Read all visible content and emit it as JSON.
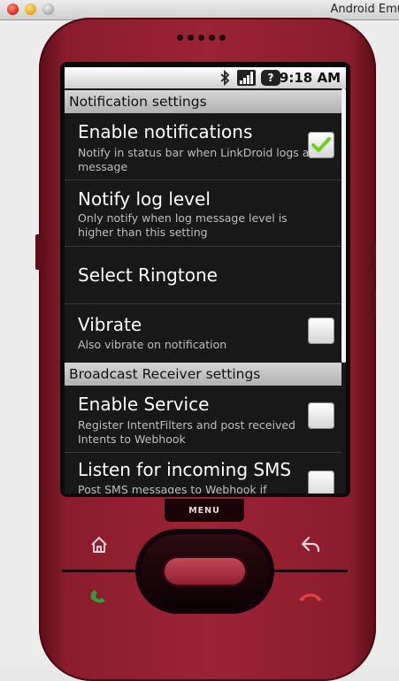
{
  "window": {
    "title": "Android Emu"
  },
  "status_bar": {
    "time": "9:18 AM",
    "icons": [
      "bluetooth-icon",
      "signal-icon",
      "battery-unknown-icon"
    ],
    "battery_glyph": "?"
  },
  "settings": {
    "section_notifications": "Notification settings",
    "enable_notifications": {
      "title": "Enable notifications",
      "summary": "Notify in status bar when LinkDroid logs a message",
      "checked": true
    },
    "notify_log_level": {
      "title": "Notify log level",
      "summary": "Only notify when log message level is higher than this setting"
    },
    "select_ringtone": {
      "title": "Select Ringtone"
    },
    "vibrate": {
      "title": "Vibrate",
      "summary": "Also vibrate on notification",
      "checked": false
    },
    "section_broadcast": "Broadcast Receiver settings",
    "enable_service": {
      "title": "Enable Service",
      "summary": "Register IntentFilters and post received Intents to Webhook",
      "checked": false
    },
    "listen_sms": {
      "title": "Listen for incoming SMS",
      "summary": "Post SMS messages to Webhook if",
      "checked": false
    }
  },
  "hardware": {
    "menu_label": "MENU",
    "buttons": [
      "home-icon",
      "back-icon",
      "call-icon",
      "end-call-icon",
      "trackball"
    ]
  },
  "colors": {
    "phone_body": "#9a2334",
    "screen_bg": "#181818",
    "check_green": "#6fd11e",
    "call_green": "#2e9e3a",
    "end_call_red": "#e04040"
  }
}
